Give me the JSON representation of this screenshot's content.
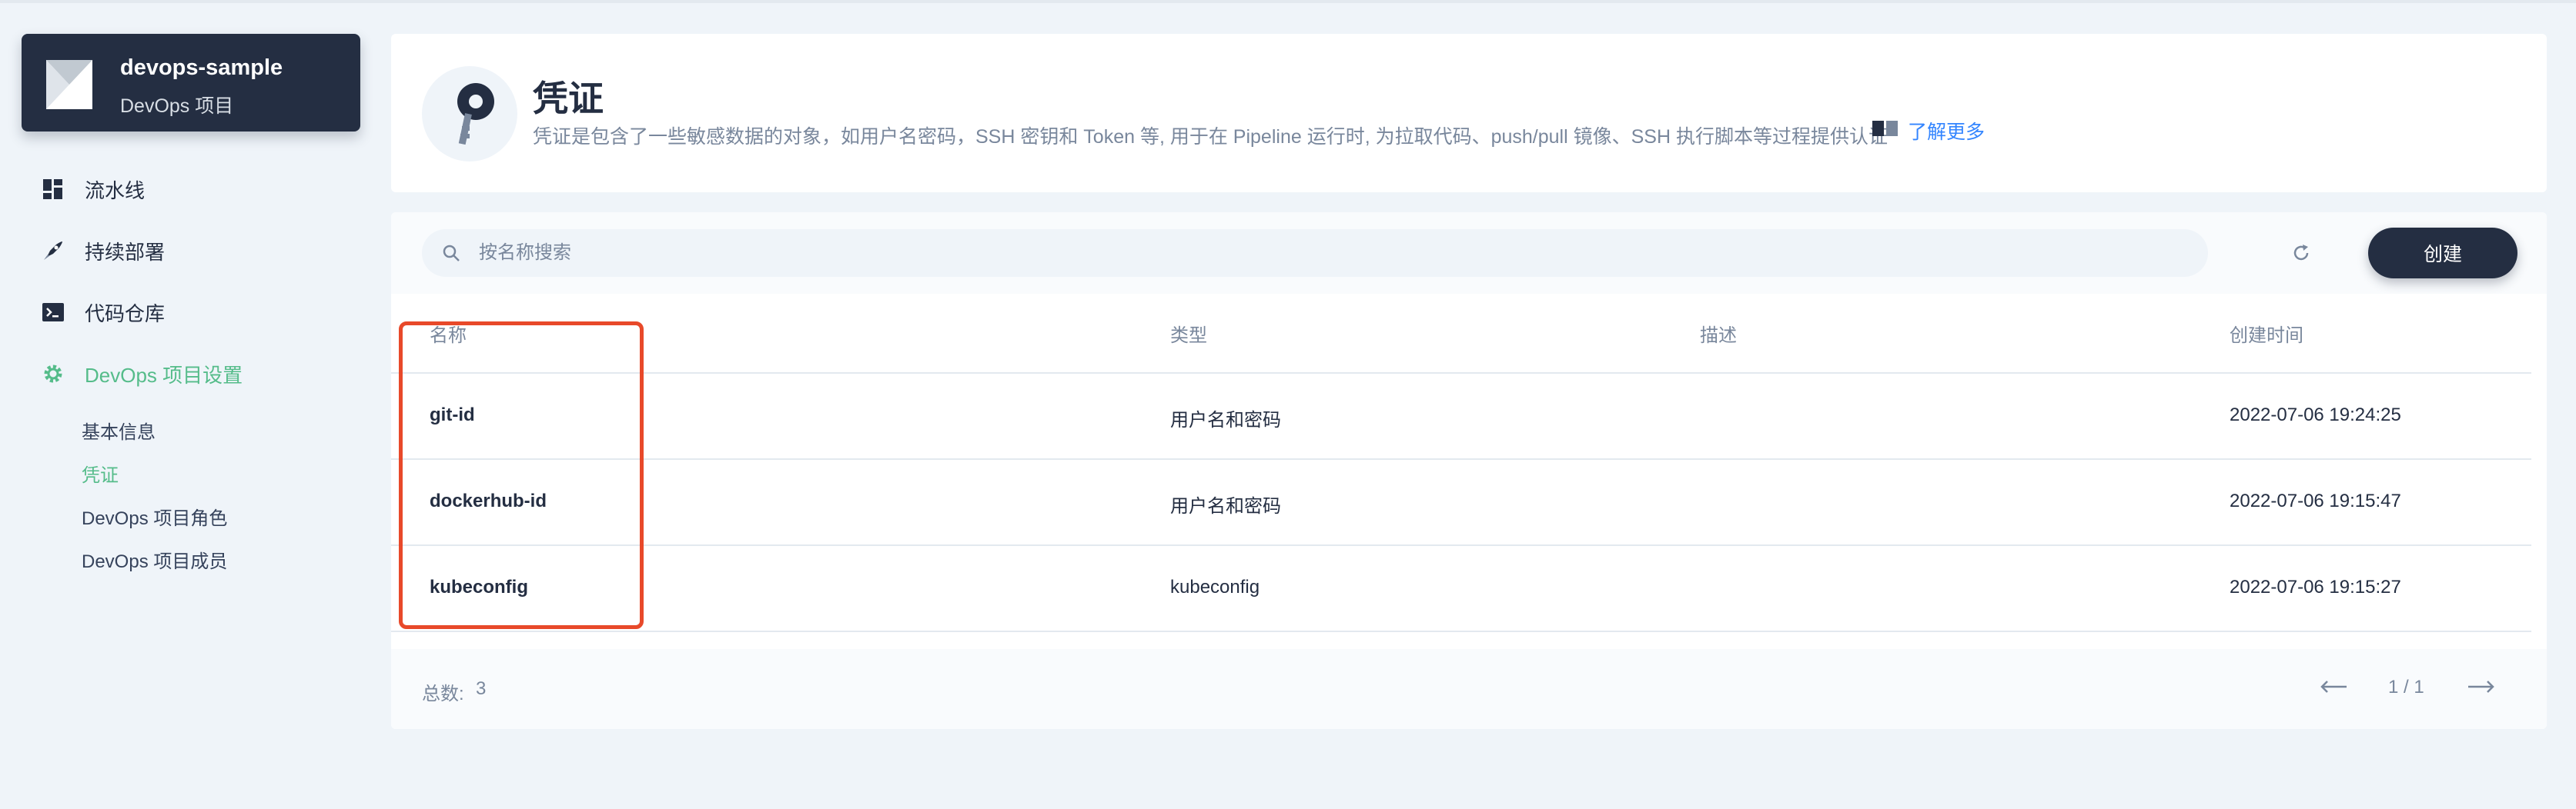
{
  "project": {
    "name": "devops-sample",
    "subtitle": "DevOps 项目"
  },
  "sidebar": {
    "items": [
      {
        "label": "流水线",
        "icon": "pipeline-icon"
      },
      {
        "label": "持续部署",
        "icon": "rocket-icon"
      },
      {
        "label": "代码仓库",
        "icon": "terminal-icon"
      },
      {
        "label": "DevOps 项目设置",
        "icon": "gear-icon"
      }
    ],
    "sub_items": [
      {
        "label": "基本信息"
      },
      {
        "label": "凭证"
      },
      {
        "label": "DevOps 项目角色"
      },
      {
        "label": "DevOps 项目成员"
      }
    ]
  },
  "header": {
    "title": "凭证",
    "description": "凭证是包含了一些敏感数据的对象，如用户名密码，SSH 密钥和 Token 等, 用于在 Pipeline 运行时, 为拉取代码、push/pull 镜像、SSH 执行脚本等过程提供认证",
    "learn_more": "了解更多"
  },
  "search": {
    "placeholder": "按名称搜索",
    "value": ""
  },
  "toolbar": {
    "create_label": "创建"
  },
  "table": {
    "columns": [
      "名称",
      "类型",
      "描述",
      "创建时间"
    ],
    "rows": [
      {
        "name": "git-id",
        "type": "用户名和密码",
        "description": "",
        "created": "2022-07-06 19:24:25"
      },
      {
        "name": "dockerhub-id",
        "type": "用户名和密码",
        "description": "",
        "created": "2022-07-06 19:15:47"
      },
      {
        "name": "kubeconfig",
        "type": "kubeconfig",
        "description": "",
        "created": "2022-07-06 19:15:27"
      }
    ]
  },
  "footer": {
    "total_label": "总数:",
    "total_count": "3",
    "page_info": "1 / 1"
  },
  "colors": {
    "accent": "#55bc8a",
    "dark": "#242e42",
    "link": "#3385ff",
    "highlight": "#e8492a"
  }
}
